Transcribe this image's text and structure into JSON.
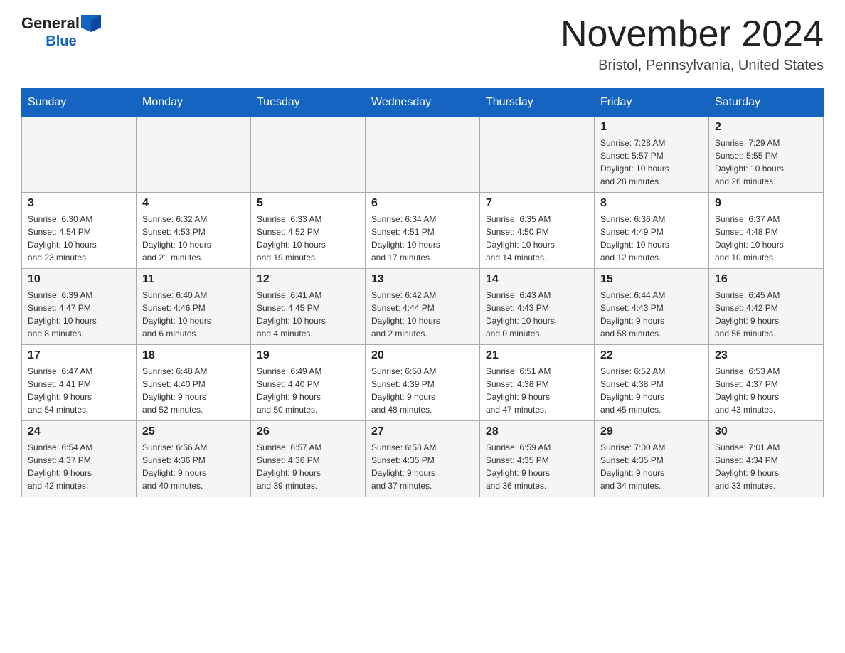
{
  "header": {
    "logo_general": "General",
    "logo_blue": "Blue",
    "month_title": "November 2024",
    "location": "Bristol, Pennsylvania, United States"
  },
  "days_of_week": [
    "Sunday",
    "Monday",
    "Tuesday",
    "Wednesday",
    "Thursday",
    "Friday",
    "Saturday"
  ],
  "weeks": [
    {
      "days": [
        {
          "num": "",
          "info": ""
        },
        {
          "num": "",
          "info": ""
        },
        {
          "num": "",
          "info": ""
        },
        {
          "num": "",
          "info": ""
        },
        {
          "num": "",
          "info": ""
        },
        {
          "num": "1",
          "info": "Sunrise: 7:28 AM\nSunset: 5:57 PM\nDaylight: 10 hours\nand 28 minutes."
        },
        {
          "num": "2",
          "info": "Sunrise: 7:29 AM\nSunset: 5:55 PM\nDaylight: 10 hours\nand 26 minutes."
        }
      ]
    },
    {
      "days": [
        {
          "num": "3",
          "info": "Sunrise: 6:30 AM\nSunset: 4:54 PM\nDaylight: 10 hours\nand 23 minutes."
        },
        {
          "num": "4",
          "info": "Sunrise: 6:32 AM\nSunset: 4:53 PM\nDaylight: 10 hours\nand 21 minutes."
        },
        {
          "num": "5",
          "info": "Sunrise: 6:33 AM\nSunset: 4:52 PM\nDaylight: 10 hours\nand 19 minutes."
        },
        {
          "num": "6",
          "info": "Sunrise: 6:34 AM\nSunset: 4:51 PM\nDaylight: 10 hours\nand 17 minutes."
        },
        {
          "num": "7",
          "info": "Sunrise: 6:35 AM\nSunset: 4:50 PM\nDaylight: 10 hours\nand 14 minutes."
        },
        {
          "num": "8",
          "info": "Sunrise: 6:36 AM\nSunset: 4:49 PM\nDaylight: 10 hours\nand 12 minutes."
        },
        {
          "num": "9",
          "info": "Sunrise: 6:37 AM\nSunset: 4:48 PM\nDaylight: 10 hours\nand 10 minutes."
        }
      ]
    },
    {
      "days": [
        {
          "num": "10",
          "info": "Sunrise: 6:39 AM\nSunset: 4:47 PM\nDaylight: 10 hours\nand 8 minutes."
        },
        {
          "num": "11",
          "info": "Sunrise: 6:40 AM\nSunset: 4:46 PM\nDaylight: 10 hours\nand 6 minutes."
        },
        {
          "num": "12",
          "info": "Sunrise: 6:41 AM\nSunset: 4:45 PM\nDaylight: 10 hours\nand 4 minutes."
        },
        {
          "num": "13",
          "info": "Sunrise: 6:42 AM\nSunset: 4:44 PM\nDaylight: 10 hours\nand 2 minutes."
        },
        {
          "num": "14",
          "info": "Sunrise: 6:43 AM\nSunset: 4:43 PM\nDaylight: 10 hours\nand 0 minutes."
        },
        {
          "num": "15",
          "info": "Sunrise: 6:44 AM\nSunset: 4:43 PM\nDaylight: 9 hours\nand 58 minutes."
        },
        {
          "num": "16",
          "info": "Sunrise: 6:45 AM\nSunset: 4:42 PM\nDaylight: 9 hours\nand 56 minutes."
        }
      ]
    },
    {
      "days": [
        {
          "num": "17",
          "info": "Sunrise: 6:47 AM\nSunset: 4:41 PM\nDaylight: 9 hours\nand 54 minutes."
        },
        {
          "num": "18",
          "info": "Sunrise: 6:48 AM\nSunset: 4:40 PM\nDaylight: 9 hours\nand 52 minutes."
        },
        {
          "num": "19",
          "info": "Sunrise: 6:49 AM\nSunset: 4:40 PM\nDaylight: 9 hours\nand 50 minutes."
        },
        {
          "num": "20",
          "info": "Sunrise: 6:50 AM\nSunset: 4:39 PM\nDaylight: 9 hours\nand 48 minutes."
        },
        {
          "num": "21",
          "info": "Sunrise: 6:51 AM\nSunset: 4:38 PM\nDaylight: 9 hours\nand 47 minutes."
        },
        {
          "num": "22",
          "info": "Sunrise: 6:52 AM\nSunset: 4:38 PM\nDaylight: 9 hours\nand 45 minutes."
        },
        {
          "num": "23",
          "info": "Sunrise: 6:53 AM\nSunset: 4:37 PM\nDaylight: 9 hours\nand 43 minutes."
        }
      ]
    },
    {
      "days": [
        {
          "num": "24",
          "info": "Sunrise: 6:54 AM\nSunset: 4:37 PM\nDaylight: 9 hours\nand 42 minutes."
        },
        {
          "num": "25",
          "info": "Sunrise: 6:56 AM\nSunset: 4:36 PM\nDaylight: 9 hours\nand 40 minutes."
        },
        {
          "num": "26",
          "info": "Sunrise: 6:57 AM\nSunset: 4:36 PM\nDaylight: 9 hours\nand 39 minutes."
        },
        {
          "num": "27",
          "info": "Sunrise: 6:58 AM\nSunset: 4:35 PM\nDaylight: 9 hours\nand 37 minutes."
        },
        {
          "num": "28",
          "info": "Sunrise: 6:59 AM\nSunset: 4:35 PM\nDaylight: 9 hours\nand 36 minutes."
        },
        {
          "num": "29",
          "info": "Sunrise: 7:00 AM\nSunset: 4:35 PM\nDaylight: 9 hours\nand 34 minutes."
        },
        {
          "num": "30",
          "info": "Sunrise: 7:01 AM\nSunset: 4:34 PM\nDaylight: 9 hours\nand 33 minutes."
        }
      ]
    }
  ]
}
